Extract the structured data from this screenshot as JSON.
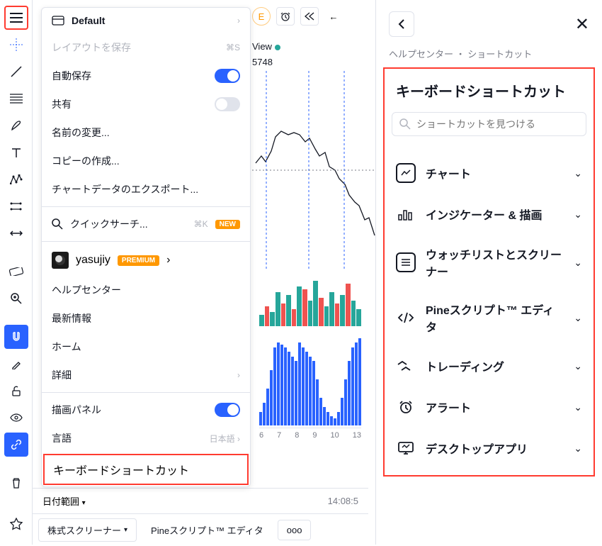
{
  "menu": {
    "default_label": "Default",
    "save_layout": "レイアウトを保存",
    "save_shortcut": "⌘S",
    "auto_save": "自動保存",
    "share": "共有",
    "rename": "名前の変更...",
    "copy": "コピーの作成...",
    "export": "チャートデータのエクスポート...",
    "quick_search": "クイックサーチ...",
    "quick_search_sc": "⌘K",
    "new_badge": "NEW",
    "username": "yasujiy",
    "premium": "PREMIUM",
    "help_center": "ヘルプセンター",
    "whatsnew": "最新情報",
    "home": "ホーム",
    "details": "詳細",
    "draw_panel": "描画パネル",
    "language": "言語",
    "language_value": "日本語",
    "keyboard_shortcuts": "キーボードショートカット"
  },
  "chart": {
    "view_label": "View",
    "price": "5748",
    "e_badge": "E"
  },
  "x_axis": [
    "6",
    "7",
    "8",
    "9",
    "10",
    "13"
  ],
  "bottom": {
    "date_range": "日付範囲",
    "time": "14:08:5",
    "stock_screener": "株式スクリーナー",
    "pine_editor": "Pineスクリプト™ エディタ",
    "more": "ooo"
  },
  "right": {
    "breadcrumb_help": "ヘルプセンター",
    "breadcrumb_sep": "・",
    "breadcrumb_shortcuts": "ショートカット",
    "title": "キーボードショートカット",
    "search_placeholder": "ショートカットを見つける",
    "categories": [
      "チャート",
      "インジケーター & 描画",
      "ウォッチリストとスクリーナー",
      "Pineスクリプト™ エディタ",
      "トレーディング",
      "アラート",
      "デスクトップアプリ"
    ]
  }
}
